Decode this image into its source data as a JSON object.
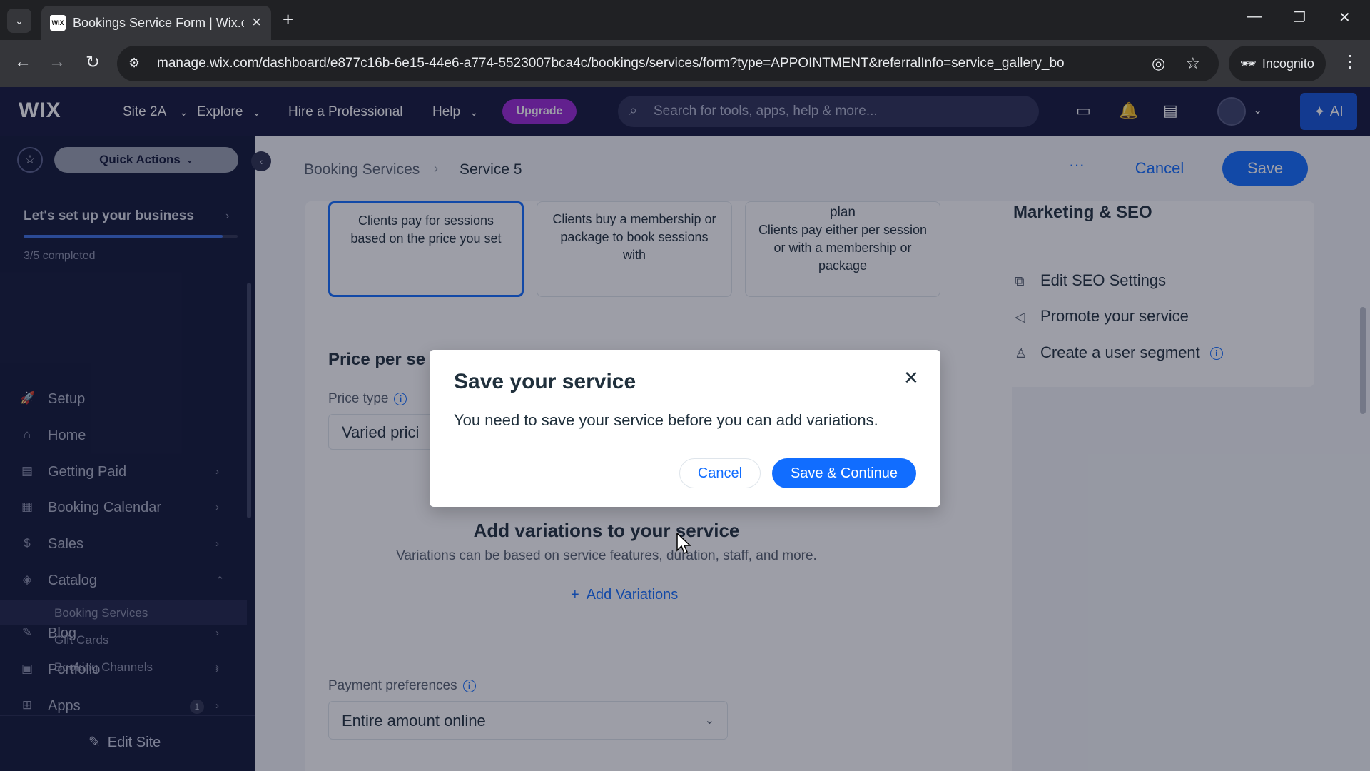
{
  "browser": {
    "tab_title": "Bookings Service Form | Wix.co",
    "tab_favicon": "WiX",
    "url": "manage.wix.com/dashboard/e877c16b-6e15-44e6-a774-5523007bca4c/bookings/services/form?type=APPOINTMENT&referralInfo=service_gallery_bo",
    "incognito_label": "Incognito"
  },
  "topbar": {
    "logo": "WIX",
    "site_name": "Site 2A",
    "explore": "Explore",
    "hire": "Hire a Professional",
    "help": "Help",
    "upgrade": "Upgrade",
    "search_placeholder": "Search for tools, apps, help & more...",
    "ai_label": "AI"
  },
  "sidebar": {
    "quick_actions": "Quick Actions",
    "setup_title": "Let's set up your business",
    "setup_progress_pct": 93,
    "setup_count": "3/5 completed",
    "items": [
      {
        "label": "Setup",
        "icon": "rocket-icon",
        "glyph": "🚀",
        "chevron": false
      },
      {
        "label": "Home",
        "icon": "home-icon",
        "glyph": "⌂",
        "chevron": false
      },
      {
        "label": "Getting Paid",
        "icon": "payment-icon",
        "glyph": "▤",
        "chevron": true
      },
      {
        "label": "Booking Calendar",
        "icon": "calendar-icon",
        "glyph": "▦",
        "chevron": true
      },
      {
        "label": "Sales",
        "icon": "dollar-icon",
        "glyph": "$",
        "chevron": true
      },
      {
        "label": "Catalog",
        "icon": "tag-icon",
        "glyph": "◈",
        "chevron": "up"
      }
    ],
    "sub_items": [
      {
        "label": "Booking Services",
        "active": true
      },
      {
        "label": "Gift Cards",
        "active": false
      },
      {
        "label": "Booking Channels",
        "active": false
      }
    ],
    "lower_items": [
      {
        "label": "Blog",
        "icon": "pen-icon",
        "glyph": "✎"
      },
      {
        "label": "Portfolio",
        "icon": "portfolio-icon",
        "glyph": "▣"
      },
      {
        "label": "Apps",
        "icon": "apps-icon",
        "glyph": "⊞",
        "badge": "1"
      }
    ],
    "edit_site": "Edit Site"
  },
  "header": {
    "breadcrumb_parent": "Booking Services",
    "breadcrumb_current": "Service 5",
    "more": "···",
    "cancel": "Cancel",
    "save": "Save"
  },
  "payment_options": [
    {
      "title": "",
      "desc": "Clients pay for sessions based on the price you set",
      "selected": true
    },
    {
      "title": "",
      "desc": "Clients buy a membership or package to book sessions with",
      "selected": false
    },
    {
      "title": "plan",
      "desc": "Clients pay either per session or with a membership or package",
      "selected": false
    }
  ],
  "price": {
    "section_title": "Price per se",
    "price_type_label": "Price type",
    "price_type_value": "Varied prici",
    "variations_title": "Add variations to your service",
    "variations_desc": "Variations can be based on service features, duration, staff, and more.",
    "add_variations": "Add Variations",
    "payment_pref_label": "Payment preferences",
    "payment_pref_value": "Entire amount online"
  },
  "marketing": {
    "title": "Marketing & SEO",
    "items": [
      {
        "label": "Edit SEO Settings",
        "icon": "seo-icon",
        "glyph": "⧉"
      },
      {
        "label": "Promote your service",
        "icon": "megaphone-icon",
        "glyph": "📢"
      },
      {
        "label": "Create a user segment",
        "icon": "users-icon",
        "glyph": "👥"
      }
    ]
  },
  "modal": {
    "title": "Save your service",
    "body": "You need to save your service before you can add variations.",
    "cancel": "Cancel",
    "save_continue": "Save & Continue"
  },
  "colors": {
    "accent": "#116dff",
    "sidebar_bg": "#0f1535",
    "topbar_bg": "#12163a",
    "upgrade": "#9a27d5"
  }
}
